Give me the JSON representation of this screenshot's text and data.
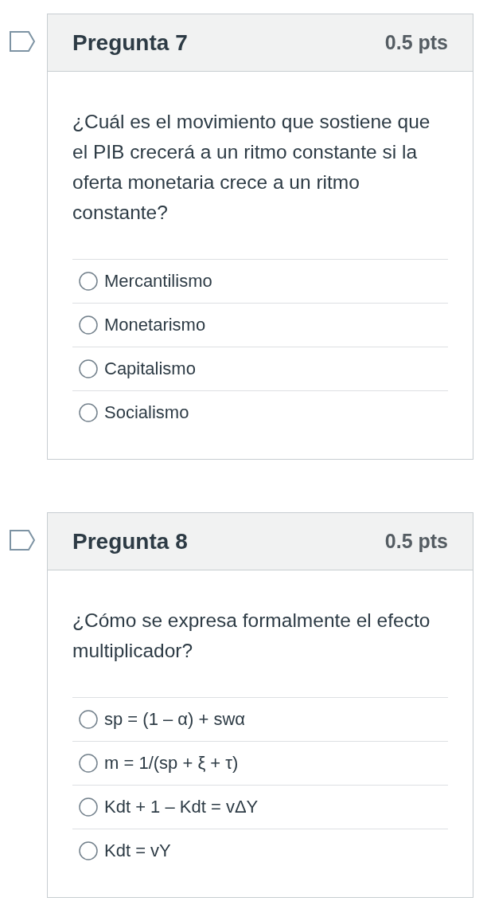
{
  "questions": [
    {
      "flagged": false,
      "title": "Pregunta 7",
      "points": "0.5 pts",
      "text": "¿Cuál es el movimiento que sostiene que el PIB crecerá a un ritmo constante si la oferta monetaria crece a un ritmo constante?",
      "answers": [
        {
          "label": "Mercantilismo",
          "selected": false
        },
        {
          "label": "Monetarismo",
          "selected": false
        },
        {
          "label": "Capitalismo",
          "selected": false
        },
        {
          "label": "Socialismo",
          "selected": false
        }
      ]
    },
    {
      "flagged": false,
      "title": "Pregunta 8",
      "points": "0.5 pts",
      "text": "¿Cómo se expresa formalmente el efecto multiplicador?",
      "answers": [
        {
          "label": "sp = (1 – α) + swα",
          "selected": false
        },
        {
          "label": "m = 1/(sp + ξ + τ)",
          "selected": false
        },
        {
          "label": "Kdt + 1 – Kdt = vΔY",
          "selected": false
        },
        {
          "label": "Kdt = vY",
          "selected": false
        }
      ]
    }
  ]
}
